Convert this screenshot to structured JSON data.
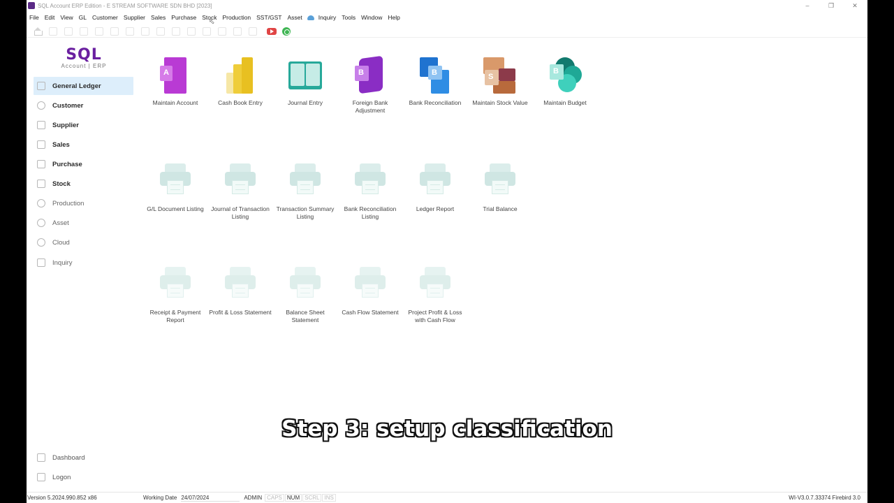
{
  "window": {
    "title": "SQL Account ERP Edition - E STREAM SOFTWARE SDN BHD [2023]"
  },
  "menu": [
    "File",
    "Edit",
    "View",
    "GL",
    "Customer",
    "Supplier",
    "Sales",
    "Purchase",
    "Stock",
    "Production",
    "SST/GST",
    "Asset",
    "Inquiry",
    "Tools",
    "Window",
    "Help"
  ],
  "logo": {
    "main": "SQL",
    "sub": "Account | ERP"
  },
  "sidebar": {
    "items": [
      {
        "label": "General Ledger",
        "active": true
      },
      {
        "label": "Customer"
      },
      {
        "label": "Supplier"
      },
      {
        "label": "Sales"
      },
      {
        "label": "Purchase"
      },
      {
        "label": "Stock"
      },
      {
        "label": "Production"
      },
      {
        "label": "Asset"
      },
      {
        "label": "Cloud"
      },
      {
        "label": "Inquiry"
      }
    ],
    "bottom": [
      {
        "label": "Dashboard"
      },
      {
        "label": "Logon"
      }
    ]
  },
  "tiles": {
    "maintain": [
      {
        "label": "Maintain Account",
        "letter": "A"
      },
      {
        "label": "Cash Book Entry"
      },
      {
        "label": "Journal Entry"
      },
      {
        "label": "Foreign Bank Adjustment",
        "letter": "B"
      },
      {
        "label": "Bank Reconciliation",
        "letter": "B"
      },
      {
        "label": "Maintain Stock Value",
        "letter": "S"
      },
      {
        "label": "Maintain Budget",
        "letter": "B"
      }
    ],
    "listings": [
      {
        "label": "G/L Document Listing"
      },
      {
        "label": "Journal of Transaction Listing"
      },
      {
        "label": "Transaction Summary Listing"
      },
      {
        "label": "Bank Reconciliation Listing"
      },
      {
        "label": "Ledger Report"
      },
      {
        "label": "Trial Balance"
      }
    ],
    "reports": [
      {
        "label": "Receipt & Payment Report"
      },
      {
        "label": "Profit & Loss Statement"
      },
      {
        "label": "Balance Sheet Statement"
      },
      {
        "label": "Cash Flow Statement"
      },
      {
        "label": "Project Profit & Loss with Cash Flow"
      }
    ]
  },
  "caption": "Step 3: setup classification",
  "status": {
    "version": "Version 5.2024.990.852 x86",
    "working_date_label": "Working Date",
    "working_date": "24/07/2024",
    "user": "ADMIN",
    "caps": "CAPS",
    "num": "NUM",
    "scrl": "SCRL",
    "ins": "INS",
    "build": "WI-V3.0.7.33374 Firebird 3.0"
  },
  "colors": {
    "brand_purple": "#6a1fa0",
    "active_bg": "#ddeefb",
    "maintain_account": "#b93ad4",
    "cash_book": "#e8c021",
    "journal": "#27a99a",
    "foreign_bank": "#a23fd6",
    "bank_recon": "#2f8de4",
    "stock_value": "#b86a3c",
    "budget": "#1fa896"
  }
}
